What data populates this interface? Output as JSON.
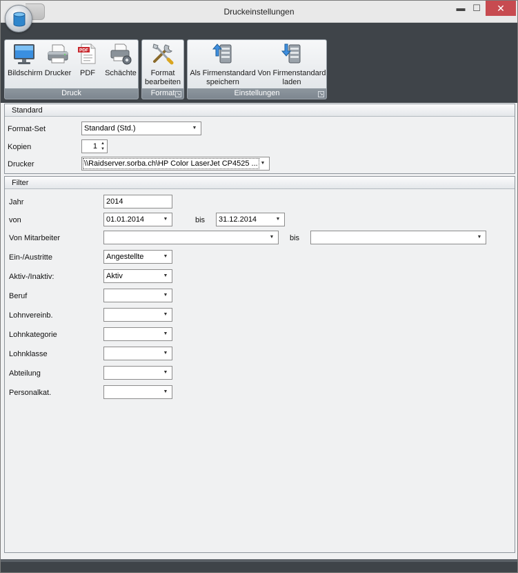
{
  "window": {
    "title": "Druckeinstellungen",
    "min_glyph": "▬",
    "max_glyph": "☐",
    "close_glyph": "✕"
  },
  "ribbon": {
    "druck": {
      "caption": "Druck",
      "buttons": {
        "bildschirm": "Bildschirm",
        "drucker": "Drucker",
        "pdf": "PDF",
        "schaechte": "Schächte"
      }
    },
    "format": {
      "caption": "Format",
      "button_line1": "Format",
      "button_line2": "bearbeiten"
    },
    "einstellungen": {
      "caption": "Einstellungen",
      "save_line1": "Als Firmenstandard",
      "save_line2": "speichern",
      "load_line1": "Von Firmenstandard",
      "load_line2": "laden"
    },
    "pdf_icon_text": "PDF"
  },
  "standard": {
    "header": "Standard",
    "format_set_label": "Format-Set",
    "format_set_value": "Standard (Std.)",
    "kopien_label": "Kopien",
    "kopien_value": "1",
    "drucker_label": "Drucker",
    "drucker_value": "\\\\Raidserver.sorba.ch\\HP Color LaserJet CP4525 ..."
  },
  "filter": {
    "header": "Filter",
    "jahr_label": "Jahr",
    "jahr_value": "2014",
    "von_label": "von",
    "von_value": "01.01.2014",
    "bis_label": "bis",
    "bis_value": "31.12.2014",
    "mitarbeiter_label": "Von Mitarbeiter",
    "mitarbeiter_value": "",
    "mitarbeiter_bis_label": "bis",
    "mitarbeiter_bis_value": "",
    "ein_austritte_label": "Ein-/Austritte",
    "ein_austritte_value": "Angestellte",
    "aktiv_label": "Aktiv-/Inaktiv:",
    "aktiv_value": "Aktiv",
    "beruf_label": "Beruf",
    "beruf_value": "",
    "lohnvereinb_label": "Lohnvereinb.",
    "lohnvereinb_value": "",
    "lohnkategorie_label": "Lohnkategorie",
    "lohnkategorie_value": "",
    "lohnklasse_label": "Lohnklasse",
    "lohnklasse_value": "",
    "abteilung_label": "Abteilung",
    "abteilung_value": "",
    "personalkat_label": "Personalkat.",
    "personalkat_value": ""
  },
  "glyphs": {
    "dropdown": "▼",
    "spin_up": "▲",
    "spin_down": "▼",
    "launcher": "↘"
  },
  "colors": {
    "ribbon_dark": "#3f4449",
    "close_red": "#c74b50",
    "caption_gray": "#7d868f"
  }
}
